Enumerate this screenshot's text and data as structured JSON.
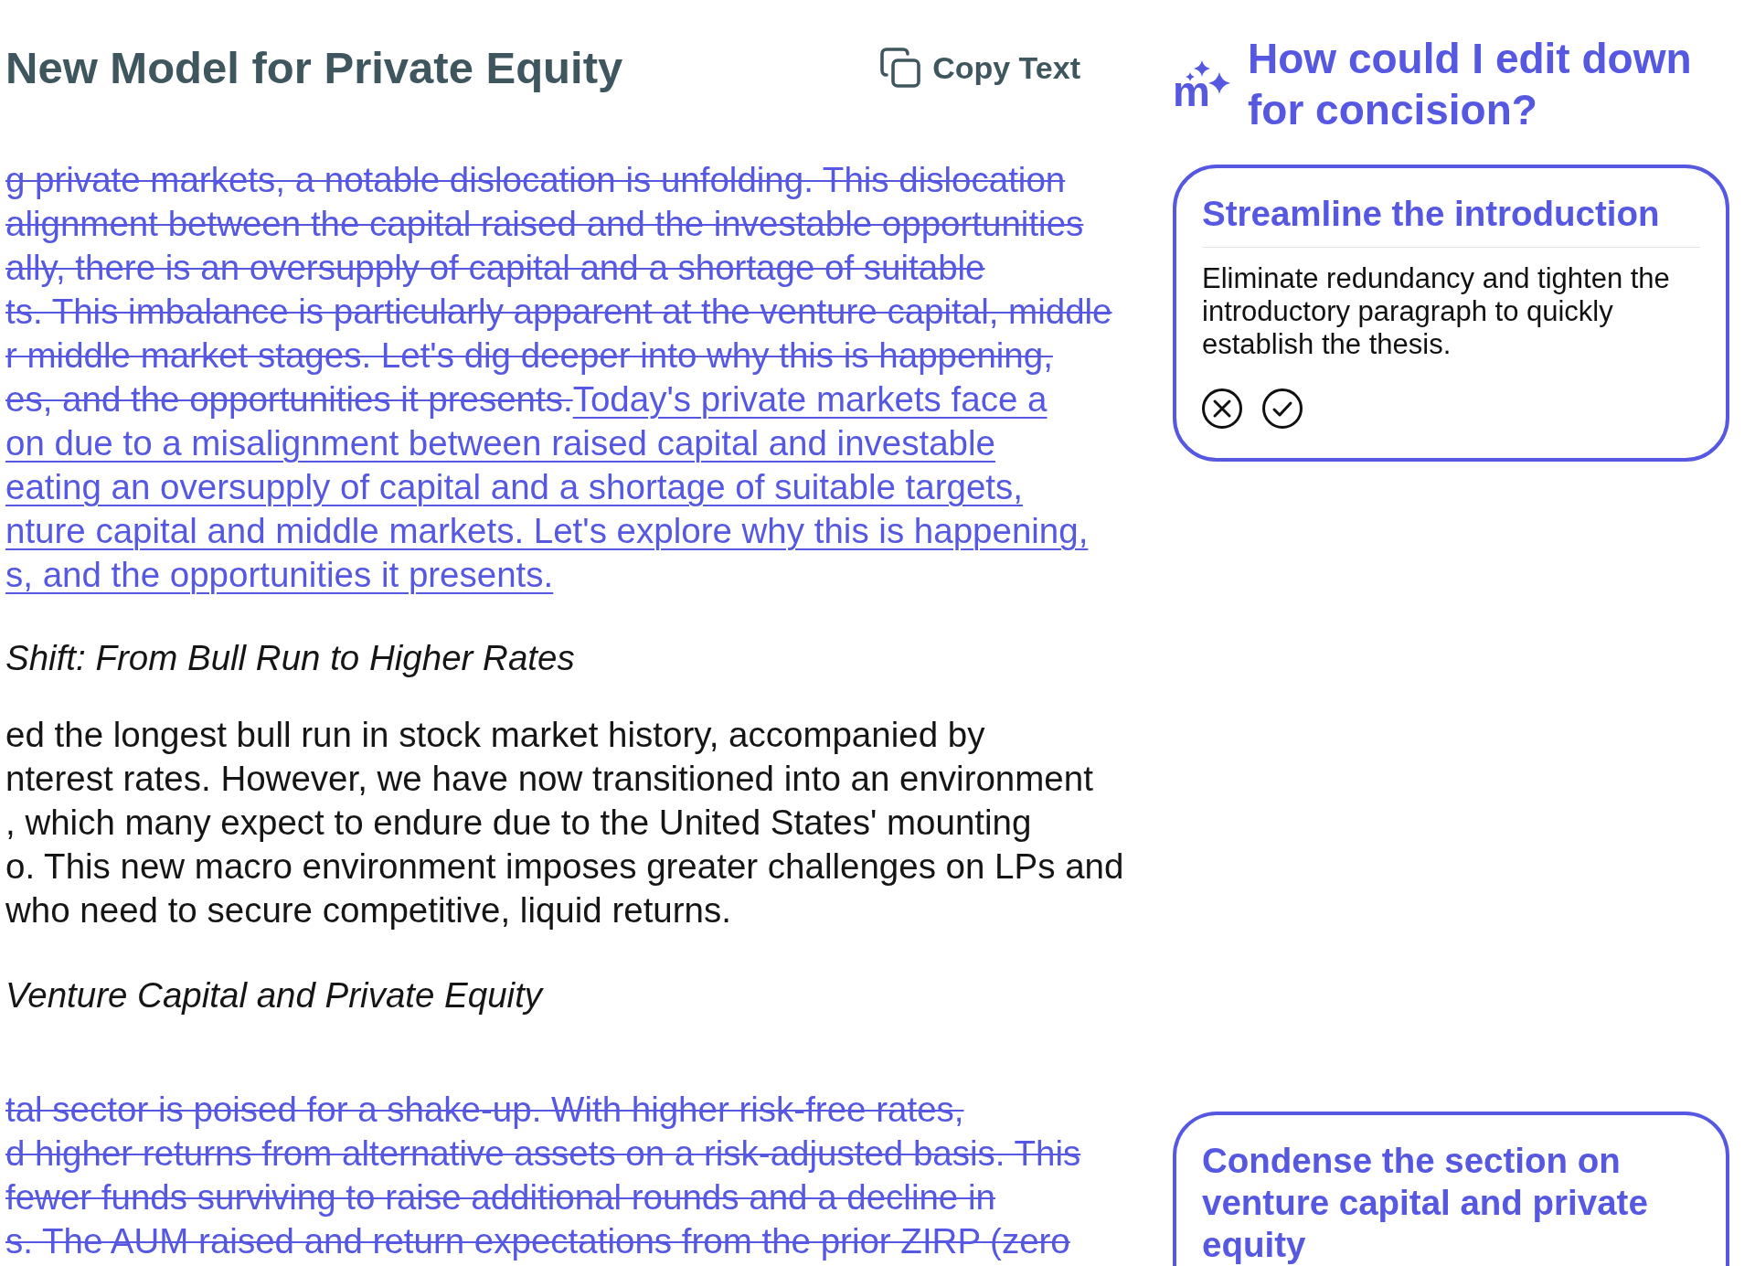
{
  "document": {
    "title": "New Model for Private Equity",
    "copy_button": {
      "label": "Copy Text"
    },
    "blocks": [
      {
        "kind": "paragraph",
        "lines": [
          [
            {
              "kind": "deleted",
              "text": "g private markets, a notable dislocation is unfolding. This dislocation"
            }
          ],
          [
            {
              "kind": "deleted",
              "text": "alignment between the capital raised and the investable opportunities"
            }
          ],
          [
            {
              "kind": "deleted",
              "text": "ally, there is an oversupply of capital and a shortage of suitable"
            }
          ],
          [
            {
              "kind": "deleted",
              "text": "ts. This imbalance is particularly apparent at the venture capital, middle"
            }
          ],
          [
            {
              "kind": "deleted",
              "text": "r middle market stages. Let's dig deeper into why this is happening,"
            }
          ],
          [
            {
              "kind": "deleted",
              "text": "es, and the opportunities it presents."
            },
            {
              "kind": "inserted",
              "text": "Today's private markets face a"
            }
          ],
          [
            {
              "kind": "inserted",
              "text": "on due to a misalignment between raised capital and investable"
            }
          ],
          [
            {
              "kind": "inserted",
              "text": "eating an oversupply of capital and a shortage of suitable targets,"
            }
          ],
          [
            {
              "kind": "inserted",
              "text": "nture capital and middle markets. Let's explore why this is happening,"
            }
          ],
          [
            {
              "kind": "inserted",
              "text": "s, and the opportunities it presents."
            }
          ]
        ]
      },
      {
        "kind": "heading",
        "text": "Shift: From Bull Run to Higher Rates"
      },
      {
        "kind": "paragraph",
        "lines": [
          [
            {
              "kind": "plain",
              "text": "ed the longest bull run in stock market history, accompanied by"
            }
          ],
          [
            {
              "kind": "plain",
              "text": "nterest rates. However, we have now transitioned into an environment"
            }
          ],
          [
            {
              "kind": "plain",
              "text": ", which many expect to endure due to the United States' mounting"
            }
          ],
          [
            {
              "kind": "plain",
              "text": "o. This new macro environment imposes greater challenges on LPs and"
            }
          ],
          [
            {
              "kind": "plain",
              "text": "who need to secure competitive, liquid returns."
            }
          ]
        ]
      },
      {
        "kind": "heading",
        "text": "Venture Capital and Private Equity"
      },
      {
        "kind": "paragraph",
        "lines": [
          [
            {
              "kind": "deleted",
              "text": "tal sector is poised for a shake-up. With higher risk-free rates,"
            }
          ],
          [
            {
              "kind": "deleted",
              "text": "d higher returns from alternative assets on a risk-adjusted basis. This"
            }
          ],
          [
            {
              "kind": "deleted",
              "text": "fewer funds surviving to raise additional rounds and a decline in"
            }
          ],
          [
            {
              "kind": "deleted",
              "text": "s. The AUM raised and return expectations from the prior ZIRP (zero"
            }
          ]
        ]
      }
    ]
  },
  "assistant": {
    "logo": "m",
    "question": "How could I edit down for concision?",
    "suggestions": [
      {
        "title": "Streamline the introduction",
        "description": "Eliminate redundancy and tighten the introductory paragraph to quickly establish the thesis."
      },
      {
        "title": "Condense the section on venture capital and private equity"
      }
    ]
  }
}
